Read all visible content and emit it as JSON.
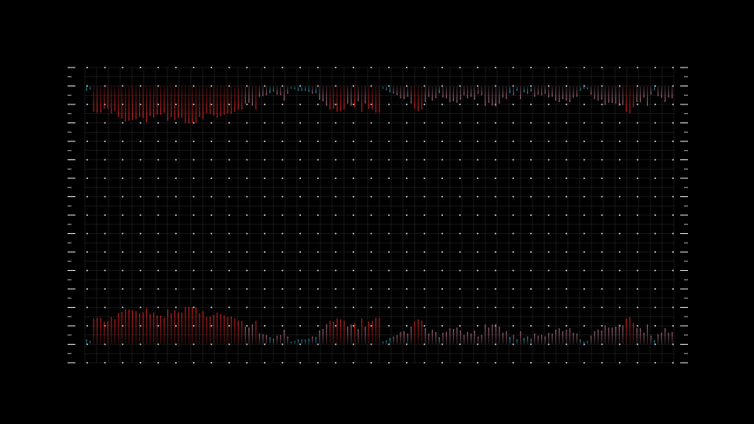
{
  "colors": {
    "background": "#000000",
    "grid_line": "#2a2a2a",
    "grid_dot": "#ffffff",
    "tick": "#ffffff",
    "high": "#c62020",
    "mid": "#a06878",
    "low": "#2aa0c0"
  },
  "chart_data": {
    "type": "bar",
    "layout": "mirrored",
    "title": "",
    "xlabel": "",
    "ylabel": "",
    "grid": true,
    "legend": "none",
    "ylim": [
      0,
      10
    ],
    "x_count": 167,
    "values": [
      0.6,
      0.4,
      3.4,
      3.5,
      3.5,
      3.0,
      3.0,
      3.6,
      3.3,
      4.1,
      4.3,
      4.7,
      4.6,
      4.5,
      4.4,
      4.1,
      4.2,
      4.8,
      4.0,
      4.2,
      3.8,
      3.8,
      3.5,
      4.6,
      4.1,
      4.5,
      4.2,
      4.2,
      4.9,
      5.0,
      4.9,
      4.9,
      4.1,
      4.4,
      3.6,
      3.7,
      3.9,
      4.2,
      4.0,
      3.8,
      3.6,
      3.7,
      3.4,
      3.1,
      3.1,
      2.3,
      2.2,
      2.6,
      3.1,
      1.4,
      1.3,
      1.2,
      0.9,
      0.7,
      1.1,
      1.2,
      1.9,
      1.0,
      0.3,
      0.4,
      0.6,
      0.6,
      0.6,
      0.7,
      1.0,
      0.9,
      1.8,
      2.0,
      2.6,
      3.1,
      3.0,
      3.4,
      3.3,
      3.1,
      2.3,
      2.6,
      2.8,
      2.0,
      3.4,
      2.3,
      3.0,
      3.1,
      3.5,
      3.5,
      0.3,
      0.5,
      0.8,
      1.0,
      1.2,
      1.6,
      1.7,
      1.4,
      2.3,
      3.0,
      3.3,
      3.1,
      2.1,
      1.4,
      1.9,
      1.6,
      0.9,
      1.5,
      1.6,
      2.1,
      2.0,
      2.2,
      1.8,
      1.2,
      1.6,
      1.4,
      1.8,
      1.0,
      1.2,
      2.6,
      2.2,
      2.6,
      2.7,
      2.3,
      1.5,
      1.7,
      0.9,
      1.2,
      0.6,
      1.7,
      0.8,
      1.0,
      0.7,
      1.4,
      1.1,
      1.2,
      1.0,
      1.5,
      1.4,
      1.9,
      2.1,
      1.7,
      1.9,
      2.1,
      1.5,
      1.4,
      0.6,
      0.3,
      0.4,
      1.1,
      1.7,
      1.9,
      1.8,
      2.5,
      2.2,
      2.2,
      2.3,
      2.6,
      2.5,
      3.4,
      3.6,
      2.8,
      2.1,
      2.1,
      1.5,
      2.6,
      1.1,
      0.5,
      1.3,
      1.5,
      2.1,
      1.5,
      1.6
    ]
  }
}
